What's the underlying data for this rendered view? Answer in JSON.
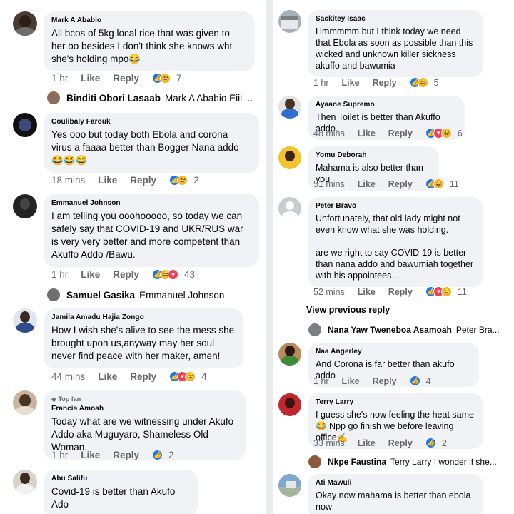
{
  "left": {
    "comments": [
      {
        "name": "Mark A Ababio",
        "text": "All bcos of 5kg local rice that was given to her oo besides I don't think she knows wht she's holding mpo😂",
        "time": "1 hr",
        "like": "Like",
        "reply": "Reply",
        "reactions": [
          "like",
          "haha"
        ],
        "count": "7"
      },
      {
        "name": "Coulibaly Farouk",
        "text": "Yes ooo but today both Ebola and corona virus a faaaa better than Bogger Nana addo 😂😂😂",
        "time": "18 mins",
        "like": "Like",
        "reply": "Reply",
        "reactions": [
          "like",
          "haha"
        ],
        "count": "2"
      },
      {
        "name": "Emmanuel Johnson",
        "text": "I am telling you ooohooooo, so today we can safely say that COVID-19 and UKR/RUS war is very very better and more competent than Akuffo Addo /Bawu.",
        "time": "1 hr",
        "like": "Like",
        "reply": "Reply",
        "reactions": [
          "like",
          "haha",
          "love"
        ],
        "count": "43"
      },
      {
        "name": "Jamila Amadu Hajia Zongo",
        "text": "How I wish she's alive to see the mess she brought upon us,anyway may her soul never find peace with her maker, amen!",
        "time": "44 mins",
        "like": "Like",
        "reply": "Reply",
        "reactions": [
          "like",
          "love",
          "wow"
        ],
        "count": "4"
      },
      {
        "top_fan": "Top fan",
        "name": "Francis Amoah",
        "text": "Today what are we witnessing under Akufo Addo aka Muguyaro, Shameless Old Woman.",
        "time": "1 hr",
        "like": "Like",
        "reply": "Reply",
        "reactions": [
          "like"
        ],
        "count": "2"
      },
      {
        "name": "Abu Salifu",
        "text": "Covid-19 is better than Akufo Ado"
      }
    ],
    "replies": [
      {
        "name": "Binditi Obori Lasaab",
        "text": "Mark A Ababio Eiii ..."
      },
      {
        "name": "Samuel Gasika",
        "text": "Emmanuel Johnson"
      }
    ]
  },
  "right": {
    "comments": [
      {
        "name": "Sackitey Isaac",
        "text": "Hmmmmm but I think today we need that Ebola as soon as possible than this wicked and unknown killer sickness akuffo and bawumia",
        "time": "1 hr",
        "like": "Like",
        "reply": "Reply",
        "reactions": [
          "like",
          "haha"
        ],
        "count": "5"
      },
      {
        "name": "Ayaane Supremo",
        "text": "Then Toilet is better than Akuffo addo.",
        "time": "48 mins",
        "like": "Like",
        "reply": "Reply",
        "reactions": [
          "like",
          "love",
          "haha"
        ],
        "count": "6"
      },
      {
        "name": "Yomu Deborah",
        "text": "Mahama is also better than  you",
        "time": "51 mins",
        "like": "Like",
        "reply": "Reply",
        "reactions": [
          "like",
          "haha"
        ],
        "count": "11"
      },
      {
        "name": "Peter Bravo",
        "text": "Unfortunately, that old lady might not even know what she was holding.",
        "text2": "are we right to say COVID-19 is better than nana addo and bawumiah together with his appointees ...",
        "time": "52 mins",
        "like": "Like",
        "reply": "Reply",
        "reactions": [
          "like",
          "love",
          "sad"
        ],
        "count": "11"
      },
      {
        "name": "Naa Angerley",
        "text": "And Corona is far better than akufo addo",
        "time": "1 hr",
        "like": "Like",
        "reply": "Reply",
        "reactions": [
          "like"
        ],
        "count": "4"
      },
      {
        "name": "Terry Larry",
        "text": "I guess she's now feeling the heat same😂 Npp go finish we before leaving office✍️",
        "time": "33 mins",
        "like": "Like",
        "reply": "Reply",
        "reactions": [
          "like"
        ],
        "count": "2"
      },
      {
        "name": "Ati Mawuli",
        "text": "Okay now mahama is better than ebola now"
      }
    ],
    "view_previous": "View previous reply",
    "replies": [
      {
        "name": "Nana Yaw Tweneboa Asamoah",
        "text": "Peter Bra..."
      },
      {
        "name": "Nkpe Faustina",
        "text": "Terry Larry I wonder if she..."
      }
    ]
  },
  "colors": {
    "bubble": "#f0f2f5",
    "meta": "#65676b",
    "like_blue": "#1877f2",
    "love_red": "#f33e58",
    "haha_yellow": "#f7b125"
  }
}
